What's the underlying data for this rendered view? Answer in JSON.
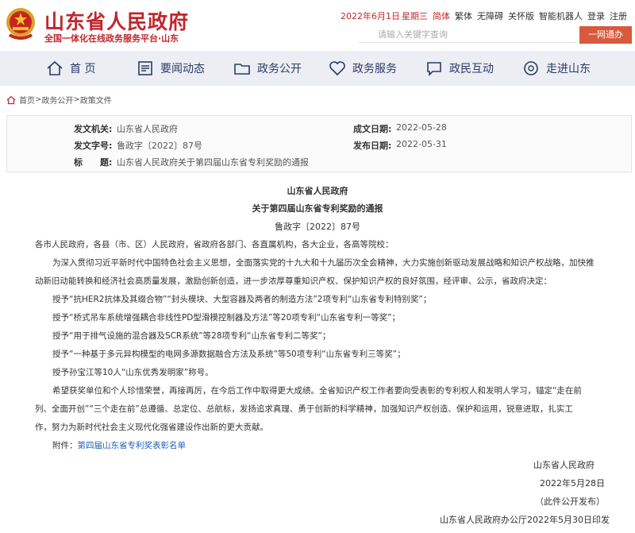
{
  "header": {
    "site_title": "山东省人民政府",
    "site_subtitle": "全国一体化在线政务服务平台·山东",
    "date": "2022年6月1日",
    "weekday": "星期三",
    "links": [
      "简体",
      "繁体",
      "无障碍",
      "关怀版",
      "智能机器人",
      "登录",
      "注册"
    ],
    "search_placeholder": "请输入关键字查询",
    "search_button": "一网通办",
    "brand_color": "#c0272d"
  },
  "nav": {
    "items": [
      {
        "label": "首 页",
        "icon": "home-icon"
      },
      {
        "label": "要闻动态",
        "icon": "news-icon"
      },
      {
        "label": "政务公开",
        "icon": "folder-icon"
      },
      {
        "label": "政务服务",
        "icon": "heart-icon"
      },
      {
        "label": "政民互动",
        "icon": "chat-icon"
      },
      {
        "label": "走进山东",
        "icon": "location-icon"
      }
    ]
  },
  "breadcrumb": {
    "items": [
      "首页",
      "政务公开",
      "政策文件"
    ]
  },
  "meta": {
    "issuer_label": "发文机关:",
    "issuer": "山东省人民政府",
    "date_label": "成文日期:",
    "date": "2022-05-28",
    "number_label": "发文字号:",
    "number": "鲁政字〔2022〕87号",
    "publish_label": "发布日期:",
    "publish": "2022-05-31",
    "title_label": "标　　题:",
    "title": "山东省人民政府关于第四届山东省专利奖励的通报"
  },
  "document": {
    "org": "山东省人民政府",
    "title": "关于第四届山东省专利奖励的通报",
    "number": "鲁政字〔2022〕87号",
    "salutation": "各市人民政府，各县（市、区）人民政府，省政府各部门、各直属机构，各大企业，各高等院校：",
    "para1_l1": "为深入贯彻习近平新时代中国特色社会主义思想，全面落实党的十九大和十九届历次全会精神，大力实施创新驱动发展战略和知识产权战略，加快推",
    "para1_l2": "动新旧动能转换和经济社会高质量发展，激励创新创造，进一步浓厚尊重知识产权、保护知识产权的良好氛围，经评审、公示，省政府决定：",
    "award1": "授予“抗HER2抗体及其缀合物”“封头模块、大型容器及两者的制造方法”2项专利“山东省专利特别奖”；",
    "award2": "授予“桥式吊车系统增强耦合非线性PD型滑模控制器及方法”等20项专利“山东省专利一等奖”；",
    "award3": "授予“用于排气设施的混合器及SCR系统”等28项专利“山东省专利二等奖”；",
    "award4": "授予“一种基于多元异构模型的电网多源数据融合方法及系统”等50项专利“山东省专利三等奖”；",
    "award5": "授予孙宝江等10人“山东优秀发明家”称号。",
    "para2_l1": "希望获奖单位和个人珍惜荣誉，再接再厉，在今后工作中取得更大成绩。全省知识产权工作者要向受表彰的专利权人和发明人学习，锚定“走在前",
    "para2_l2": "列、全面开创”“三个走在前”总遵循、总定位、总航标，发扬追求真理、勇于创新的科学精神，加强知识产权创造、保护和运用，锐意进取，扎实工",
    "para2_l3": "作，努力为新时代社会主义现代化强省建设作出新的更大贡献。",
    "attachment_label": "附件：",
    "attachment_link": "第四届山东省专利奖表彰名单",
    "sign_org": "山东省人民政府",
    "sign_date": "2022年5月28日",
    "public_note": "（此件公开发布）",
    "print_note": "山东省人民政府办公厅2022年5月30日印发"
  }
}
